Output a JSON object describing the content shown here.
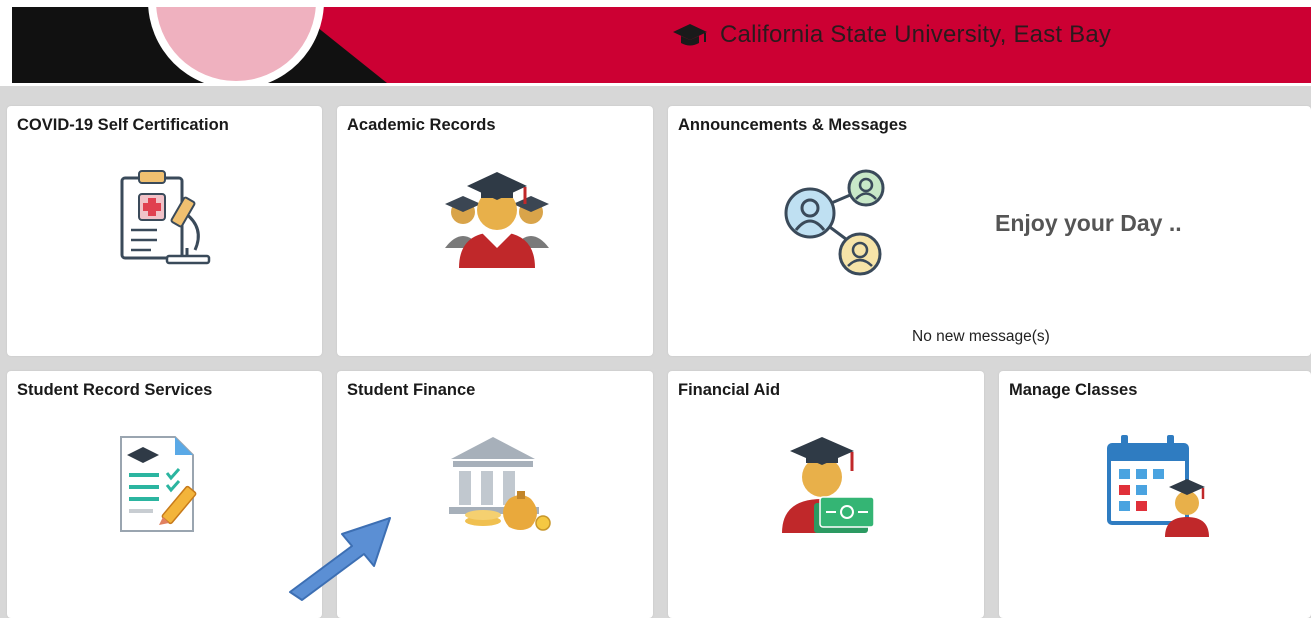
{
  "header": {
    "university_name": "California State University, East Bay",
    "brand_red": "#cc0033",
    "icon": "graduation-cap-icon"
  },
  "tiles": [
    {
      "title": "COVID-19 Self Certification",
      "icon": "clipboard-microscope-icon"
    },
    {
      "title": "Academic Records",
      "icon": "graduates-icon"
    },
    {
      "title": "Announcements & Messages",
      "icon": "people-network-icon",
      "greeting": "Enjoy your Day ..",
      "status": "No new message(s)"
    },
    {
      "title": "Student Record Services",
      "icon": "document-checklist-icon"
    },
    {
      "title": "Student Finance",
      "icon": "bank-money-icon"
    },
    {
      "title": "Financial Aid",
      "icon": "graduate-money-icon"
    },
    {
      "title": "Manage Classes",
      "icon": "calendar-graduate-icon"
    }
  ],
  "annotation": {
    "icon": "blue-arrow-icon",
    "color": "#5b8fd4"
  }
}
